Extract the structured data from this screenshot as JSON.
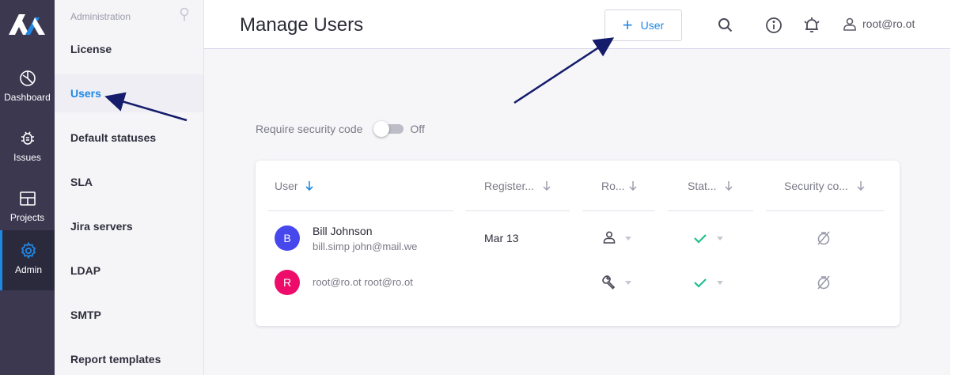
{
  "rail": {
    "items": [
      {
        "label": "Dashboard",
        "icon": "dashboard-icon"
      },
      {
        "label": "Issues",
        "icon": "bug-icon"
      },
      {
        "label": "Projects",
        "icon": "projects-icon"
      },
      {
        "label": "Admin",
        "icon": "gear-icon",
        "active": true
      }
    ]
  },
  "subnav": {
    "header": "Administration",
    "items": [
      {
        "label": "License"
      },
      {
        "label": "Users",
        "active": true
      },
      {
        "label": "Default statuses"
      },
      {
        "label": "SLA"
      },
      {
        "label": "Jira servers"
      },
      {
        "label": "LDAP"
      },
      {
        "label": "SMTP"
      },
      {
        "label": "Report templates"
      }
    ]
  },
  "header": {
    "title": "Manage Users",
    "add_button_label": "User",
    "user_label": "root@ro.ot"
  },
  "security": {
    "label": "Require security code",
    "state": "Off"
  },
  "table": {
    "columns": [
      "User",
      "Register...",
      "Ro...",
      "Stat...",
      "Security co..."
    ],
    "rows": [
      {
        "initial": "B",
        "name": "Bill Johnson",
        "email": "bill.simp john@mail.we",
        "registered": "Mar 13",
        "role_icon": "person-icon",
        "status_icon": "check-icon",
        "security_icon": "no-security-icon"
      },
      {
        "initial": "R",
        "name": "",
        "email": "root@ro.ot root@ro.ot",
        "registered": "",
        "role_icon": "wrench-icon",
        "status_icon": "check-icon",
        "security_icon": "no-security-icon"
      }
    ]
  },
  "colors": {
    "accent": "#1f88e5",
    "rail_bg": "#3b3850",
    "avatar_b": "#4747ee",
    "avatar_r": "#ee0c6a",
    "check": "#1fbf8f",
    "arrow": "#141c6b"
  }
}
